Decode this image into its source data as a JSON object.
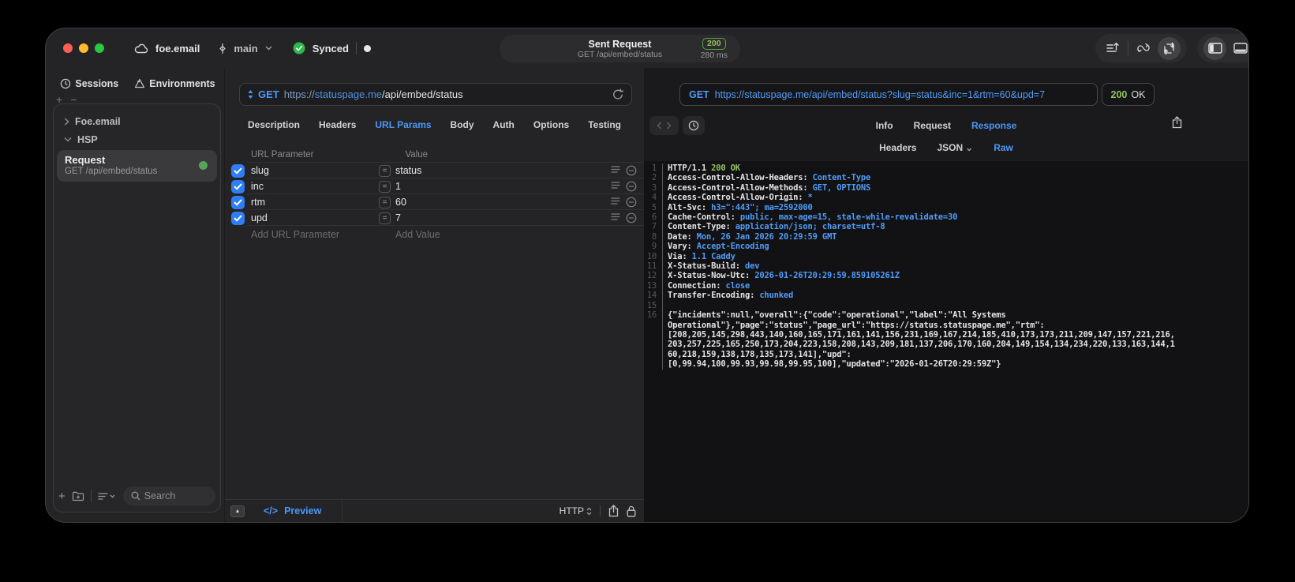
{
  "window": {
    "project": "foe.email",
    "branch": "main",
    "sync_status": "Synced",
    "center": {
      "title": "Sent Request",
      "subtitle": "GET /api/embed/status",
      "status_code": "200",
      "duration": "280 ms"
    }
  },
  "sidebar": {
    "tabs": [
      {
        "label": "Sessions"
      },
      {
        "label": "Environments"
      }
    ],
    "tree": [
      {
        "label": "Foe.email"
      },
      {
        "label": "HSP"
      }
    ],
    "selected_request": {
      "title": "Request",
      "subtitle": "GET /api/embed/status"
    },
    "search_placeholder": "Search"
  },
  "request_panel": {
    "method": "GET",
    "url_scheme": "https://",
    "url_host": "statuspage.me",
    "url_path": "/api/embed/status",
    "tabs": [
      {
        "label": "Description"
      },
      {
        "label": "Headers"
      },
      {
        "label": "URL Params",
        "active": true
      },
      {
        "label": "Body"
      },
      {
        "label": "Auth"
      },
      {
        "label": "Options"
      },
      {
        "label": "Testing"
      }
    ],
    "params": {
      "col_name": "URL Parameter",
      "col_value": "Value",
      "rows": [
        {
          "name": "slug",
          "value": "status",
          "checked": true
        },
        {
          "name": "inc",
          "value": "1",
          "checked": true
        },
        {
          "name": "rtm",
          "value": "60",
          "checked": true
        },
        {
          "name": "upd",
          "value": "7",
          "checked": true
        }
      ],
      "add_name": "Add URL Parameter",
      "add_value": "Add Value"
    },
    "footer": {
      "preview": "Preview",
      "protocol": "HTTP"
    }
  },
  "response_panel": {
    "method": "GET",
    "url": "https://statuspage.me/api/embed/status?slug=status&inc=1&rtm=60&upd=7",
    "status_code": "200",
    "status_text": "OK",
    "tabs": [
      {
        "label": "Info"
      },
      {
        "label": "Request"
      },
      {
        "label": "Response",
        "active": true
      }
    ],
    "subtabs": [
      {
        "label": "Headers"
      },
      {
        "label": "JSON",
        "chevron": true
      },
      {
        "label": "Raw",
        "active": true
      }
    ],
    "lines": [
      {
        "n": "1",
        "s": [
          [
            "HTTP/1.1 ",
            "w"
          ],
          [
            "200 OK",
            "g"
          ]
        ]
      },
      {
        "n": "2",
        "s": [
          [
            "Access-Control-Allow-Headers: ",
            "w"
          ],
          [
            "Content-Type",
            "b"
          ]
        ]
      },
      {
        "n": "3",
        "s": [
          [
            "Access-Control-Allow-Methods: ",
            "w"
          ],
          [
            "GET, OPTIONS",
            "b"
          ]
        ]
      },
      {
        "n": "4",
        "s": [
          [
            "Access-Control-Allow-Origin: ",
            "w"
          ],
          [
            "*",
            "b"
          ]
        ]
      },
      {
        "n": "5",
        "s": [
          [
            "Alt-Svc: ",
            "w"
          ],
          [
            "h3=\":443\"; ma=2592000",
            "b"
          ]
        ]
      },
      {
        "n": "6",
        "s": [
          [
            "Cache-Control: ",
            "w"
          ],
          [
            "public, max-age=15, stale-while-revalidate=30",
            "b"
          ]
        ]
      },
      {
        "n": "7",
        "s": [
          [
            "Content-Type: ",
            "w"
          ],
          [
            "application/json; charset=utf-8",
            "b"
          ]
        ]
      },
      {
        "n": "8",
        "s": [
          [
            "Date: ",
            "w"
          ],
          [
            "Mon, 26 Jan 2026 20:29:59 GMT",
            "b"
          ]
        ]
      },
      {
        "n": "9",
        "s": [
          [
            "Vary: ",
            "w"
          ],
          [
            "Accept-Encoding",
            "b"
          ]
        ]
      },
      {
        "n": "10",
        "s": [
          [
            "Via: ",
            "w"
          ],
          [
            "1.1 Caddy",
            "b"
          ]
        ]
      },
      {
        "n": "11",
        "s": [
          [
            "X-Status-Build: ",
            "w"
          ],
          [
            "dev",
            "b"
          ]
        ]
      },
      {
        "n": "12",
        "s": [
          [
            "X-Status-Now-Utc: ",
            "w"
          ],
          [
            "2026-01-26T20:29:59.859105261Z",
            "b"
          ]
        ]
      },
      {
        "n": "13",
        "s": [
          [
            "Connection: ",
            "w"
          ],
          [
            "close",
            "b"
          ]
        ]
      },
      {
        "n": "14",
        "s": [
          [
            "Transfer-Encoding: ",
            "w"
          ],
          [
            "chunked",
            "b"
          ]
        ]
      },
      {
        "n": "15",
        "s": []
      },
      {
        "n": "16",
        "s": [
          [
            "{\"incidents\":null,\"overall\":{\"code\":\"operational\",\"label\":\"All Systems",
            "w"
          ]
        ]
      },
      {
        "n": "",
        "s": [
          [
            "Operational\"},\"page\":\"status\",\"page_url\":\"https://status.statuspage.me\",\"rtm\":",
            "w"
          ]
        ]
      },
      {
        "n": "",
        "s": [
          [
            "[208,205,145,298,443,140,160,165,171,161,141,156,231,169,167,214,185,410,173,173,211,209,147,157,221,216,",
            "w"
          ]
        ]
      },
      {
        "n": "",
        "s": [
          [
            "203,257,225,165,250,173,204,223,158,208,143,209,181,137,206,170,160,204,149,154,134,234,220,133,163,144,1",
            "w"
          ]
        ]
      },
      {
        "n": "",
        "s": [
          [
            "60,218,159,138,178,135,173,141],\"upd\":",
            "w"
          ]
        ]
      },
      {
        "n": "",
        "s": [
          [
            "[0,99.94,100,99.93,99.98,99.95,100],\"updated\":\"2026-01-26T20:29:59Z\"}",
            "w"
          ]
        ]
      }
    ]
  },
  "icons": {
    "accent_blue": "#4a97f6",
    "status_green": "#8fc45f",
    "checkbox_blue": "#2f7df8"
  }
}
